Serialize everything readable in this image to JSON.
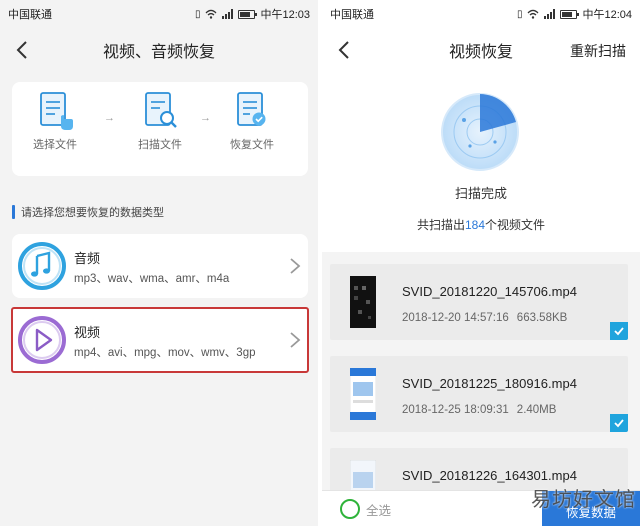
{
  "status_left": {
    "carrier": "中国联通",
    "time": "中午12:03"
  },
  "status_right": {
    "carrier": "中国联通",
    "time": "中午12:04"
  },
  "left": {
    "title": "视频、音频恢复",
    "steps": [
      {
        "label": "选择文件",
        "icon": "select-file-icon"
      },
      {
        "label": "扫描文件",
        "icon": "scan-file-icon"
      },
      {
        "label": "恢复文件",
        "icon": "restore-file-icon"
      }
    ],
    "arrow": "→",
    "section_title": "请选择您想要恢复的数据类型",
    "types": [
      {
        "name": "音频",
        "formats": "mp3、wav、wma、amr、m4a",
        "icon": "music-note-icon",
        "color": "#1c9ad6"
      },
      {
        "name": "视频",
        "formats": "mp4、avi、mpg、mov、wmv、3gp",
        "icon": "play-icon",
        "color": "#8b5cc6"
      }
    ]
  },
  "right": {
    "title": "视频恢复",
    "action": "重新扫描",
    "scan_status": "扫描完成",
    "count_prefix": "共扫描出",
    "count": "184",
    "count_suffix": "个视频文件",
    "files": [
      {
        "name": "SVID_20181220_145706.mp4",
        "date": "2018-12-20 14:57:16",
        "size": "663.58KB"
      },
      {
        "name": "SVID_20181225_180916.mp4",
        "date": "2018-12-25 18:09:31",
        "size": "2.40MB"
      },
      {
        "name": "SVID_20181226_164301.mp4",
        "date": "",
        "size": ""
      }
    ],
    "select_all": "全选",
    "recover_button": "恢复数据"
  },
  "watermark": "易坊好文馆",
  "colors": {
    "accent": "#2a78d8",
    "check": "#1fa4dd",
    "select_ring": "#2fb33a",
    "highlight": "#c83838"
  }
}
